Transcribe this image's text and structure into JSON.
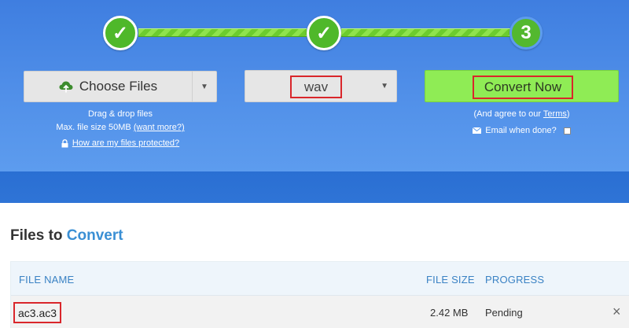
{
  "steps": [
    {
      "label": "✓",
      "state": "done"
    },
    {
      "label": "✓",
      "state": "done"
    },
    {
      "label": "3",
      "state": "current"
    }
  ],
  "upload": {
    "button_label": "Choose Files",
    "icon": "cloud-upload-icon",
    "drag_text": "Drag & drop files",
    "max_size_text": "Max. file size 50MB",
    "want_more_link": "(want more?)",
    "protected_link": "How are my files protected?"
  },
  "format": {
    "selected": "wav"
  },
  "convert": {
    "button_label": "Convert Now",
    "agree_prefix": "(And agree to our ",
    "terms_link": "Terms",
    "agree_suffix": ")",
    "email_label": "Email when done?"
  },
  "files": {
    "title_prefix": "Files to",
    "title_accent": "Convert",
    "columns": {
      "name": "FILE NAME",
      "size": "FILE SIZE",
      "progress": "PROGRESS"
    },
    "rows": [
      {
        "name": "ac3.ac3",
        "size": "2.42 MB",
        "status": "Pending",
        "remove": "×"
      }
    ]
  },
  "colors": {
    "hero_blue": "#4f8ee8",
    "step_green": "#4fb82a",
    "convert_green": "#8fec55",
    "highlight_red": "#d9262b",
    "accent_blue": "#3a8fd4"
  }
}
